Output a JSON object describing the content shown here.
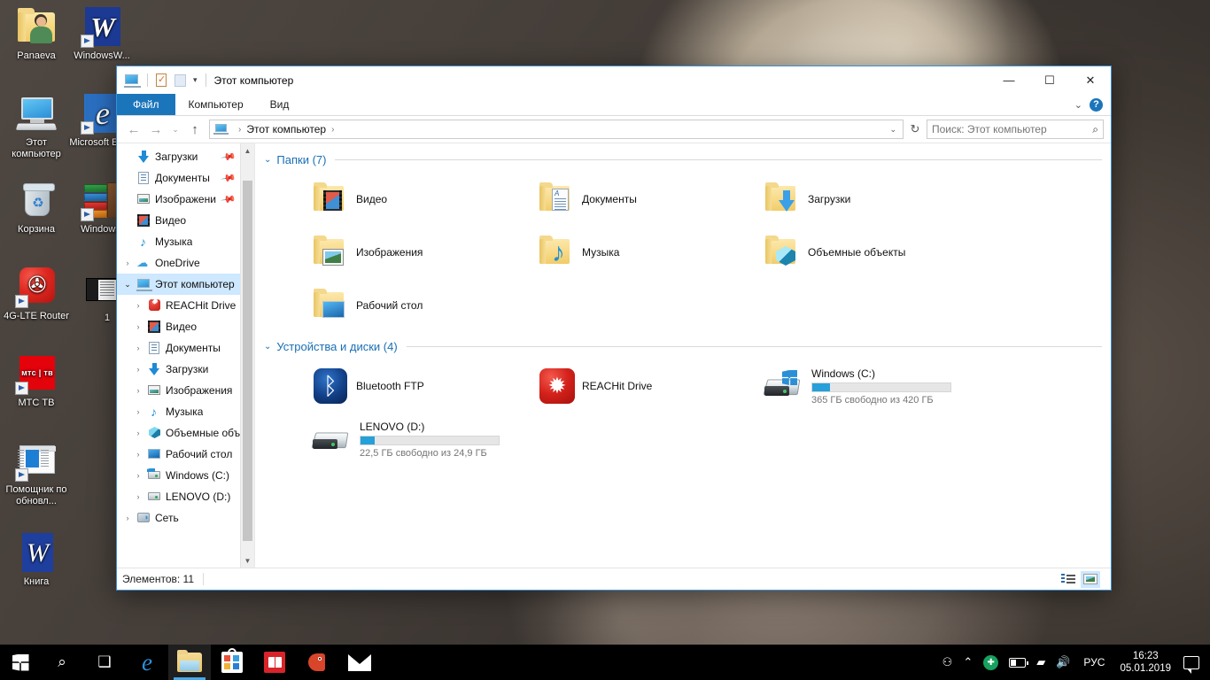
{
  "desktop": {
    "icons": [
      {
        "label": "Panaeva",
        "kind": "user-folder",
        "shortcut": false
      },
      {
        "label": "WindowsW...",
        "kind": "word-doc",
        "shortcut": true
      },
      {
        "label": "Этот компьютер",
        "kind": "this-pc",
        "shortcut": false
      },
      {
        "label": "Microsoft Edge",
        "kind": "edge",
        "shortcut": true
      },
      {
        "label": "Корзина",
        "kind": "recycle-bin",
        "shortcut": false
      },
      {
        "label": "WindowsI",
        "kind": "books",
        "shortcut": true
      },
      {
        "label": "4G-LTE Router",
        "kind": "router-app",
        "shortcut": true
      },
      {
        "label": "1",
        "kind": "thumbnail-doc",
        "shortcut": false
      },
      {
        "label": "МТС ТВ",
        "kind": "mts-app",
        "shortcut": true,
        "icon_text": "мтс | тв"
      },
      {
        "label": "Помощник по обновл...",
        "kind": "update-assistant",
        "shortcut": true
      },
      {
        "label": "Книга",
        "kind": "word-plain",
        "shortcut": false
      }
    ]
  },
  "explorer": {
    "title": "Этот компьютер",
    "quick_access": {
      "pc_icon": "this-pc-icon",
      "properties_icon": "properties-icon",
      "new_folder_icon": "new-folder-icon",
      "customize_caret": "▾"
    },
    "window_controls": {
      "minimize": "—",
      "maximize": "☐",
      "close": "✕"
    },
    "ribbon": {
      "tabs": [
        {
          "label": "Файл",
          "active": true
        },
        {
          "label": "Компьютер",
          "active": false
        },
        {
          "label": "Вид",
          "active": false
        }
      ],
      "collapse_icon": "chevron-down-icon",
      "help_label": "?"
    },
    "address": {
      "back_icon": "←",
      "forward_icon": "→",
      "recent_icon": "⌄",
      "up_icon": "↑",
      "breadcrumb": [
        "Этот компьютер"
      ],
      "dropdown_icon": "⌄",
      "refresh_icon": "↻"
    },
    "search": {
      "placeholder": "Поиск: Этот компьютер",
      "icon": "search-icon"
    },
    "navpane": {
      "items": [
        {
          "label": "Загрузки",
          "icon": "downloads-icon",
          "indent": 1,
          "expander": "",
          "pinned": true,
          "selected": false
        },
        {
          "label": "Документы",
          "icon": "documents-icon",
          "indent": 1,
          "expander": "",
          "pinned": true,
          "selected": false
        },
        {
          "label": "Изображени",
          "icon": "pictures-icon",
          "indent": 1,
          "expander": "",
          "pinned": true,
          "selected": false
        },
        {
          "label": "Видео",
          "icon": "videos-icon",
          "indent": 1,
          "expander": "",
          "pinned": false,
          "selected": false
        },
        {
          "label": "Музыка",
          "icon": "music-icon",
          "indent": 1,
          "expander": "",
          "pinned": false,
          "selected": false
        },
        {
          "label": "OneDrive",
          "icon": "onedrive-icon",
          "indent": 0,
          "expander": "›",
          "pinned": false,
          "selected": false
        },
        {
          "label": "Этот компьютер",
          "icon": "this-pc-icon",
          "indent": 0,
          "expander": "⌄",
          "pinned": false,
          "selected": true
        },
        {
          "label": "REACHit Drive",
          "icon": "reachit-icon",
          "indent": 1,
          "expander": "›",
          "pinned": false,
          "selected": false
        },
        {
          "label": "Видео",
          "icon": "videos-icon",
          "indent": 1,
          "expander": "›",
          "pinned": false,
          "selected": false
        },
        {
          "label": "Документы",
          "icon": "documents-icon",
          "indent": 1,
          "expander": "›",
          "pinned": false,
          "selected": false
        },
        {
          "label": "Загрузки",
          "icon": "downloads-icon",
          "indent": 1,
          "expander": "›",
          "pinned": false,
          "selected": false
        },
        {
          "label": "Изображения",
          "icon": "pictures-icon",
          "indent": 1,
          "expander": "›",
          "pinned": false,
          "selected": false
        },
        {
          "label": "Музыка",
          "icon": "music-icon",
          "indent": 1,
          "expander": "›",
          "pinned": false,
          "selected": false
        },
        {
          "label": "Объемные объе",
          "icon": "3d-objects-icon",
          "indent": 1,
          "expander": "›",
          "pinned": false,
          "selected": false
        },
        {
          "label": "Рабочий стол",
          "icon": "desktop-icon",
          "indent": 1,
          "expander": "›",
          "pinned": false,
          "selected": false
        },
        {
          "label": "Windows (C:)",
          "icon": "windows-drive-icon",
          "indent": 1,
          "expander": "›",
          "pinned": false,
          "selected": false
        },
        {
          "label": "LENOVO (D:)",
          "icon": "drive-icon",
          "indent": 1,
          "expander": "›",
          "pinned": false,
          "selected": false
        },
        {
          "label": "Сеть",
          "icon": "network-icon",
          "indent": 0,
          "expander": "›",
          "pinned": false,
          "selected": false
        }
      ]
    },
    "groups": [
      {
        "title": "Папки (7)",
        "chevron": "⌄",
        "items": [
          {
            "label": "Видео",
            "icon": "folder-videos-icon"
          },
          {
            "label": "Документы",
            "icon": "folder-documents-icon"
          },
          {
            "label": "Загрузки",
            "icon": "folder-downloads-icon"
          },
          {
            "label": "Изображения",
            "icon": "folder-pictures-icon"
          },
          {
            "label": "Музыка",
            "icon": "folder-music-icon"
          },
          {
            "label": "Объемные объекты",
            "icon": "folder-3d-icon"
          },
          {
            "label": "Рабочий стол",
            "icon": "folder-desktop-icon"
          }
        ]
      },
      {
        "title": "Устройства и диски (4)",
        "chevron": "⌄",
        "items": [
          {
            "label": "Bluetooth FTP",
            "icon": "bluetooth-icon",
            "type": "device"
          },
          {
            "label": "REACHit Drive",
            "icon": "reachit-icon",
            "type": "device"
          },
          {
            "label": "Windows (C:)",
            "icon": "windows-drive-icon",
            "type": "drive",
            "free_text": "365 ГБ свободно из 420 ГБ",
            "used_percent": 13,
            "bar_color": "#26a0da"
          },
          {
            "label": "LENOVO (D:)",
            "icon": "drive-icon",
            "type": "drive",
            "free_text": "22,5 ГБ свободно из 24,9 ГБ",
            "used_percent": 10,
            "bar_color": "#26a0da"
          }
        ]
      }
    ],
    "statusbar": {
      "items_text": "Элементов: 11",
      "view_details_icon": "details-view-icon",
      "view_tiles_icon": "large-icons-view-icon"
    }
  },
  "taskbar": {
    "buttons": [
      {
        "name": "start-button",
        "icon": "windows-logo-icon"
      },
      {
        "name": "search-button",
        "icon": "search-icon"
      },
      {
        "name": "task-view-button",
        "icon": "task-view-icon"
      },
      {
        "name": "edge-button",
        "icon": "edge-icon"
      },
      {
        "name": "file-explorer-button",
        "icon": "folder-icon",
        "active": true
      },
      {
        "name": "store-button",
        "icon": "store-icon"
      },
      {
        "name": "book-button",
        "icon": "book-icon"
      },
      {
        "name": "bird-app-button",
        "icon": "bird-icon"
      },
      {
        "name": "mail-button",
        "icon": "mail-icon"
      }
    ],
    "tray": {
      "people_icon": "people-icon",
      "show_hidden_icon": "chevron-up-icon",
      "green_app_icon": "green-status-icon",
      "battery_icon": "battery-icon",
      "wifi_icon": "wifi-icon",
      "volume_icon": "volume-icon",
      "language": "РУС",
      "time": "16:23",
      "date": "05.01.2019",
      "notifications_icon": "notifications-icon"
    }
  }
}
